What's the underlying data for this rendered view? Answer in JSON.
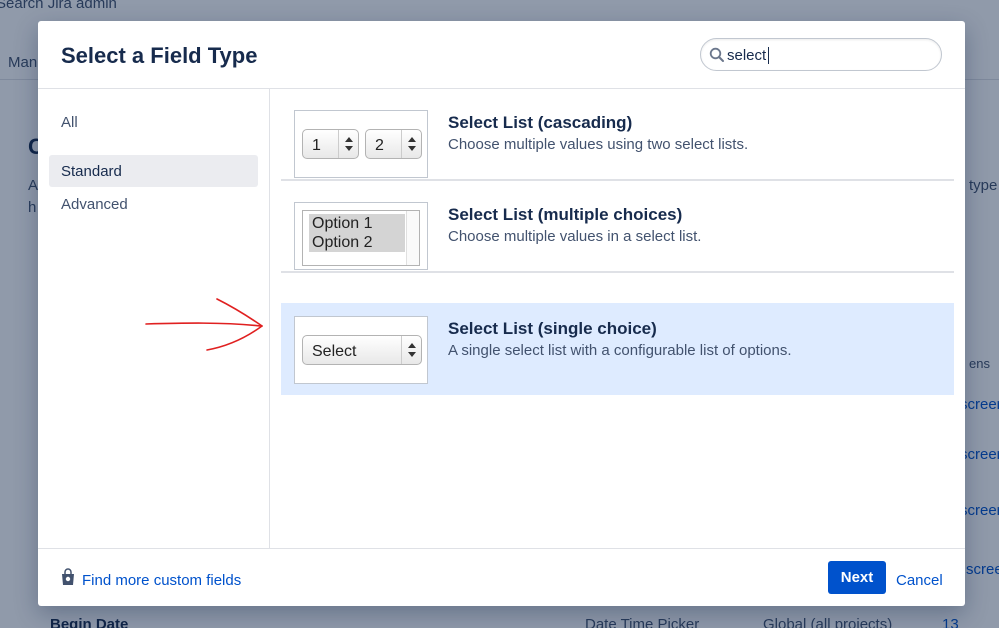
{
  "background": {
    "search_text": "Search Jira admin",
    "nav_item": "Man",
    "frag_c": "C",
    "frag_a": "A",
    "frag_h": "h",
    "frag_type": "type",
    "frag_ens": "ens",
    "frag_screen": "screen",
    "frag_screen_2": "screen",
    "frag_screen_3": "screen",
    "frag_screen_4": "scree",
    "row_name": "Begin Date",
    "row_type": "Date Time Picker",
    "row_context": "Global (all projects)",
    "row_screens": "13 scree"
  },
  "dialog": {
    "title": "Select a Field Type",
    "search": {
      "value": "select",
      "icon": "search-icon"
    }
  },
  "sidebar": {
    "items": [
      {
        "label": "All",
        "active": false
      },
      {
        "label": "Standard",
        "active": true
      },
      {
        "label": "Advanced",
        "active": false
      }
    ]
  },
  "field_types": [
    {
      "title": "Select List (cascading)",
      "description": "Choose multiple values using two select lists.",
      "preview": {
        "select_1": "1",
        "select_2": "2"
      }
    },
    {
      "title": "Select List (multiple choices)",
      "description": "Choose multiple values in a select list.",
      "preview": {
        "option_1": "Option 1",
        "option_2": "Option 2"
      }
    },
    {
      "title": "Select List (single choice)",
      "description": "A single select list with a configurable list of options.",
      "preview": {
        "select_label": "Select"
      },
      "selected": true
    }
  ],
  "footer": {
    "link_label": "Find more custom fields",
    "next_label": "Next",
    "cancel_label": "Cancel"
  },
  "colors": {
    "primary": "#0052cc",
    "selected_row": "#deebff",
    "annotation": "#e02020"
  }
}
